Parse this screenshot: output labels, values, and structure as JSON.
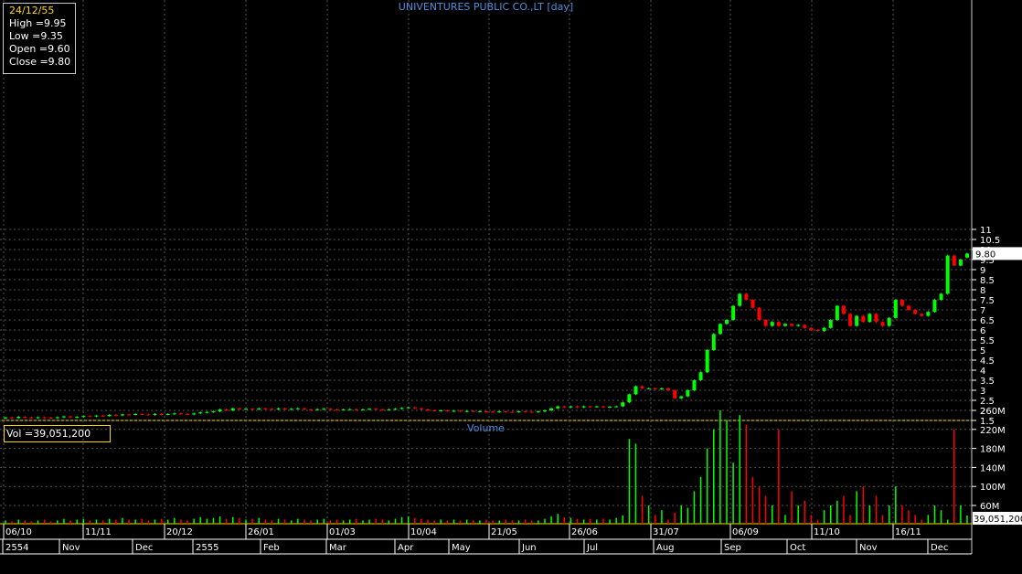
{
  "title": "UNIVENTURES PUBLIC CO.,LT [day]",
  "volume_title": "Volume",
  "info": {
    "date": "24/12/55",
    "high": "High  =9.95",
    "low": "Low  =9.35",
    "open": "Open  =9.60",
    "close": "Close  =9.80"
  },
  "vol_label": " Vol  =39,051,200",
  "last_price_label": "9.80",
  "last_volume_label": "39,051,200",
  "colors": {
    "up": "#00ff00",
    "down": "#ff0000",
    "grid": "#555555",
    "axis_line": "#ffd700",
    "title": "#4a90e2"
  },
  "chart_data": {
    "type": "candlestick",
    "price_axis": {
      "min": 1.5,
      "max": 11,
      "ticks": [
        "1.5",
        "2",
        "2.5",
        "3",
        "3.5",
        "4",
        "4.5",
        "5",
        "5.5",
        "6",
        "6.5",
        "7",
        "7.5",
        "8",
        "8.5",
        "9",
        "9.5",
        "10",
        "10.5",
        "11"
      ]
    },
    "volume_axis": {
      "ticks": [
        "60M",
        "100M",
        "140M",
        "180M",
        "220M",
        "260M"
      ]
    },
    "date_labels": [
      "06/10",
      "11/11",
      "20/12",
      "26/01",
      "01/03",
      "10/04",
      "21/05",
      "26/06",
      "31/07",
      "06/09",
      "11/10",
      "16/11"
    ],
    "month_labels": [
      "2554",
      "Nov",
      "Dec",
      "2555",
      "Feb",
      "Mar",
      "Apr",
      "May",
      "Jun",
      "Jul",
      "Aug",
      "Sep",
      "Oct",
      "Nov",
      "Dec"
    ],
    "grid": true,
    "candles": [
      [
        1.6,
        1.65
      ],
      [
        1.65,
        1.62
      ],
      [
        1.62,
        1.68
      ],
      [
        1.68,
        1.65
      ],
      [
        1.65,
        1.62
      ],
      [
        1.62,
        1.66
      ],
      [
        1.66,
        1.64
      ],
      [
        1.64,
        1.62
      ],
      [
        1.62,
        1.66
      ],
      [
        1.66,
        1.7
      ],
      [
        1.7,
        1.65
      ],
      [
        1.65,
        1.68
      ],
      [
        1.68,
        1.72
      ],
      [
        1.72,
        1.7
      ],
      [
        1.7,
        1.74
      ],
      [
        1.74,
        1.72
      ],
      [
        1.72,
        1.78
      ],
      [
        1.78,
        1.75
      ],
      [
        1.75,
        1.8
      ],
      [
        1.8,
        1.78
      ],
      [
        1.78,
        1.82
      ],
      [
        1.82,
        1.8
      ],
      [
        1.8,
        1.78
      ],
      [
        1.78,
        1.82
      ],
      [
        1.82,
        1.8
      ],
      [
        1.8,
        1.82
      ],
      [
        1.82,
        1.85
      ],
      [
        1.85,
        1.82
      ],
      [
        1.82,
        1.8
      ],
      [
        1.8,
        1.85
      ],
      [
        1.85,
        1.9
      ],
      [
        1.9,
        1.92
      ],
      [
        1.92,
        1.95
      ],
      [
        1.95,
        2.05
      ],
      [
        2.05,
        2.0
      ],
      [
        2.0,
        2.1
      ],
      [
        2.1,
        2.05
      ],
      [
        2.05,
        2.08
      ],
      [
        2.08,
        2.05
      ],
      [
        2.05,
        2.1
      ],
      [
        2.1,
        2.08
      ],
      [
        2.08,
        2.05
      ],
      [
        2.05,
        2.1
      ],
      [
        2.1,
        2.05
      ],
      [
        2.05,
        2.08
      ],
      [
        2.08,
        2.1
      ],
      [
        2.1,
        2.05
      ],
      [
        2.05,
        2.03
      ],
      [
        2.03,
        2.06
      ],
      [
        2.06,
        2.08
      ],
      [
        2.08,
        2.05
      ],
      [
        2.05,
        2.03
      ],
      [
        2.03,
        2.05
      ],
      [
        2.05,
        2.06
      ],
      [
        2.06,
        2.04
      ],
      [
        2.04,
        2.05
      ],
      [
        2.05,
        2.08
      ],
      [
        2.08,
        2.05
      ],
      [
        2.05,
        2.03
      ],
      [
        2.03,
        2.05
      ],
      [
        2.05,
        2.08
      ],
      [
        2.08,
        2.12
      ],
      [
        2.12,
        2.15
      ],
      [
        2.15,
        2.1
      ],
      [
        2.1,
        2.05
      ],
      [
        2.05,
        2.0
      ],
      [
        2.0,
        1.98
      ],
      [
        1.98,
        2.0
      ],
      [
        2.0,
        1.96
      ],
      [
        1.96,
        1.98
      ],
      [
        1.98,
        1.95
      ],
      [
        1.95,
        1.97
      ],
      [
        1.97,
        1.94
      ],
      [
        1.94,
        1.96
      ],
      [
        1.96,
        1.94
      ],
      [
        1.94,
        1.92
      ],
      [
        1.92,
        1.95
      ],
      [
        1.95,
        1.93
      ],
      [
        1.93,
        1.92
      ],
      [
        1.92,
        1.95
      ],
      [
        1.95,
        1.93
      ],
      [
        1.93,
        1.92
      ],
      [
        1.92,
        1.95
      ],
      [
        1.95,
        2.0
      ],
      [
        2.0,
        2.1
      ],
      [
        2.1,
        2.2
      ],
      [
        2.2,
        2.15
      ],
      [
        2.15,
        2.2
      ],
      [
        2.2,
        2.15
      ],
      [
        2.15,
        2.2
      ],
      [
        2.2,
        2.18
      ],
      [
        2.18,
        2.2
      ],
      [
        2.2,
        2.15
      ],
      [
        2.15,
        2.18
      ],
      [
        2.18,
        2.2
      ],
      [
        2.2,
        2.4
      ],
      [
        2.4,
        2.8
      ],
      [
        2.8,
        3.2
      ],
      [
        3.2,
        3.1
      ],
      [
        3.1,
        3.1
      ],
      [
        3.1,
        3.05
      ],
      [
        3.05,
        3.1
      ],
      [
        3.1,
        3.0
      ],
      [
        3.0,
        2.6
      ],
      [
        2.6,
        2.7
      ],
      [
        2.7,
        3.0
      ],
      [
        3.0,
        3.5
      ],
      [
        3.5,
        3.9
      ],
      [
        3.9,
        5.0
      ],
      [
        5.0,
        5.8
      ],
      [
        5.8,
        6.3
      ],
      [
        6.3,
        6.5
      ],
      [
        6.5,
        7.2
      ],
      [
        7.2,
        7.8
      ],
      [
        7.8,
        7.5
      ],
      [
        7.5,
        7.1
      ],
      [
        7.1,
        6.5
      ],
      [
        6.5,
        6.2
      ],
      [
        6.2,
        6.4
      ],
      [
        6.4,
        6.2
      ],
      [
        6.2,
        6.3
      ],
      [
        6.3,
        6.2
      ],
      [
        6.2,
        6.25
      ],
      [
        6.25,
        6.1
      ],
      [
        6.1,
        6.0
      ],
      [
        6.0,
        5.95
      ],
      [
        5.95,
        6.1
      ],
      [
        6.1,
        6.5
      ],
      [
        6.5,
        7.2
      ],
      [
        7.2,
        6.8
      ],
      [
        6.8,
        6.2
      ],
      [
        6.2,
        6.7
      ],
      [
        6.7,
        6.4
      ],
      [
        6.4,
        6.8
      ],
      [
        6.8,
        6.4
      ],
      [
        6.4,
        6.2
      ],
      [
        6.2,
        6.6
      ],
      [
        6.6,
        7.5
      ],
      [
        7.5,
        7.2
      ],
      [
        7.2,
        7.0
      ],
      [
        7.0,
        6.8
      ],
      [
        6.8,
        6.7
      ],
      [
        6.7,
        6.9
      ],
      [
        6.9,
        7.5
      ],
      [
        7.5,
        7.8
      ],
      [
        7.8,
        9.7
      ],
      [
        9.7,
        9.2
      ],
      [
        9.2,
        9.5
      ],
      [
        9.6,
        9.8
      ]
    ],
    "volumes_m": [
      4,
      3,
      5,
      4,
      3,
      4,
      5,
      3,
      4,
      6,
      4,
      5,
      6,
      4,
      5,
      4,
      6,
      5,
      7,
      5,
      5,
      6,
      4,
      5,
      6,
      5,
      7,
      5,
      4,
      6,
      8,
      6,
      7,
      9,
      6,
      8,
      7,
      5,
      6,
      7,
      5,
      4,
      6,
      5,
      4,
      6,
      5,
      4,
      5,
      6,
      4,
      5,
      4,
      5,
      6,
      4,
      5,
      6,
      5,
      4,
      6,
      8,
      9,
      7,
      6,
      5,
      4,
      5,
      4,
      5,
      4,
      5,
      4,
      4,
      5,
      4,
      4,
      5,
      4,
      4,
      5,
      4,
      4,
      6,
      9,
      12,
      8,
      7,
      6,
      5,
      6,
      5,
      6,
      5,
      7,
      10,
      200,
      190,
      80,
      60,
      40,
      50,
      30,
      45,
      60,
      55,
      90,
      120,
      180,
      220,
      260,
      240,
      150,
      250,
      230,
      120,
      100,
      80,
      60,
      220,
      40,
      90,
      60,
      70,
      40,
      30,
      50,
      60,
      70,
      80,
      40,
      90,
      100,
      60,
      80,
      40,
      60,
      100,
      60,
      50,
      40,
      30,
      40,
      60,
      50,
      30,
      220,
      60,
      39
    ]
  }
}
